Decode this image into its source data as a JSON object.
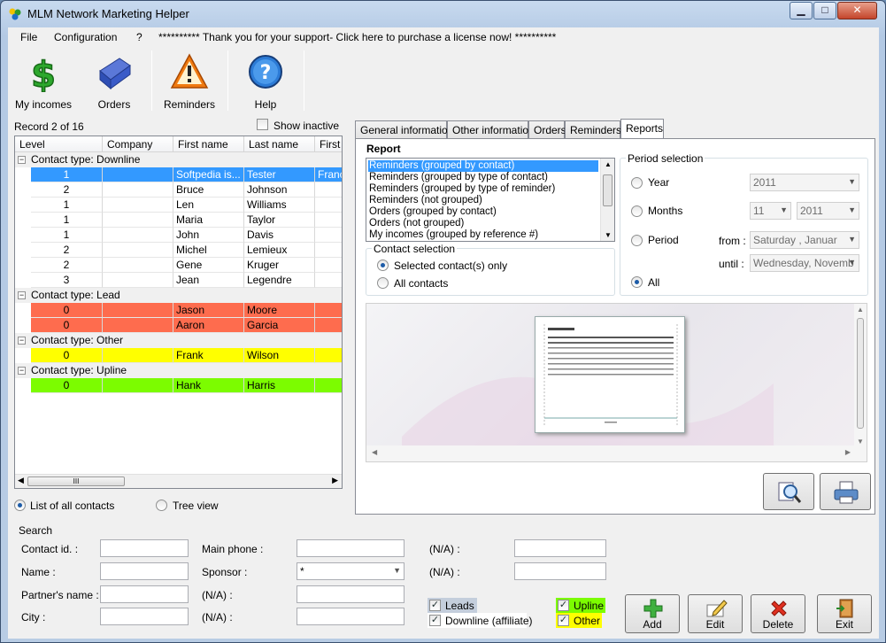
{
  "window": {
    "title": "MLM Network Marketing Helper",
    "minimize": "▁",
    "maximize": "□",
    "close": "✕"
  },
  "menu": {
    "file": "File",
    "configuration": "Configuration",
    "help": "?",
    "license": "********** Thank you for your support- Click here to purchase a license now! **********"
  },
  "toolbar": {
    "incomes": "My incomes",
    "orders": "Orders",
    "reminders": "Reminders",
    "help": "Help"
  },
  "left": {
    "record": "Record 2 of 16",
    "show_inactive": "Show inactive",
    "columns": [
      "Level",
      "Company",
      "First name",
      "Last name",
      "First"
    ],
    "groups": [
      {
        "label": "Contact type: Downline",
        "color": "#ffffff",
        "rows": [
          {
            "level": "1",
            "company": "",
            "first": "Softpedia is...",
            "last": "Tester",
            "extra": "Franc",
            "selected": true
          },
          {
            "level": "2",
            "company": "",
            "first": "Bruce",
            "last": "Johnson",
            "extra": ""
          },
          {
            "level": "1",
            "company": "",
            "first": "Len",
            "last": "Williams",
            "extra": ""
          },
          {
            "level": "1",
            "company": "",
            "first": "Maria",
            "last": "Taylor",
            "extra": ""
          },
          {
            "level": "1",
            "company": "",
            "first": "John",
            "last": "Davis",
            "extra": ""
          },
          {
            "level": "2",
            "company": "",
            "first": "Michel",
            "last": "Lemieux",
            "extra": ""
          },
          {
            "level": "2",
            "company": "",
            "first": "Gene",
            "last": "Kruger",
            "extra": ""
          },
          {
            "level": "3",
            "company": "",
            "first": "Jean",
            "last": "Legendre",
            "extra": ""
          }
        ]
      },
      {
        "label": "Contact type: Lead",
        "color": "#fe6c4e",
        "rows": [
          {
            "level": "0",
            "company": "",
            "first": "Jason",
            "last": "Moore",
            "extra": ""
          },
          {
            "level": "0",
            "company": "",
            "first": "Aaron",
            "last": "Garcia",
            "extra": ""
          }
        ]
      },
      {
        "label": "Contact type: Other",
        "color": "#ffff00",
        "rows": [
          {
            "level": "0",
            "company": "",
            "first": "Frank",
            "last": "Wilson",
            "extra": ""
          }
        ]
      },
      {
        "label": "Contact type: Upline",
        "color": "#7cfc00",
        "rows": [
          {
            "level": "0",
            "company": "",
            "first": "Hank",
            "last": "Harris",
            "extra": ""
          }
        ]
      }
    ],
    "scroll_grip": "III",
    "view_list": "List of all contacts",
    "view_tree": "Tree view"
  },
  "tabs": [
    "General information",
    "Other information",
    "Orders",
    "Reminders",
    "Reports"
  ],
  "reports": {
    "title": "Report",
    "items": [
      "Reminders (grouped by contact)",
      "Reminders (grouped by type of contact)",
      "Reminders (grouped by type of reminder)",
      "Reminders (not grouped)",
      "Orders (grouped by contact)",
      "Orders (not grouped)",
      "My incomes (grouped by reference #)"
    ],
    "contact_selection": "Contact selection",
    "selected_only": "Selected contact(s) only",
    "all_contacts": "All contacts",
    "period_selection": "Period selection",
    "year": "Year",
    "year_value": "2011",
    "months": "Months",
    "month_value": "11",
    "month_year_value": "2011",
    "period": "Period",
    "from": "from :",
    "from_value": "Saturday  ,  Januar",
    "until": "until :",
    "until_value": "Wednesday, Novemb",
    "all": "All"
  },
  "search": {
    "title": "Search",
    "contact_id": "Contact id. :",
    "name": "Name :",
    "partner": "Partner's name :",
    "city": "City :",
    "main_phone": "Main phone :",
    "sponsor": "Sponsor :",
    "sponsor_value": "*",
    "na1": "(N/A) :",
    "na2": "(N/A) :",
    "na3": "(N/A) :",
    "na4": "(N/A) :",
    "leads": "Leads",
    "downline": "Downline (affiliate)",
    "upline": "Upline",
    "other": "Other"
  },
  "actions": {
    "add": "Add",
    "edit": "Edit",
    "delete": "Delete",
    "exit": "Exit"
  },
  "colors": {
    "selected": "#3399ff",
    "lead": "#fe6c4e",
    "other": "#ffff00",
    "upline": "#7cfc00"
  }
}
